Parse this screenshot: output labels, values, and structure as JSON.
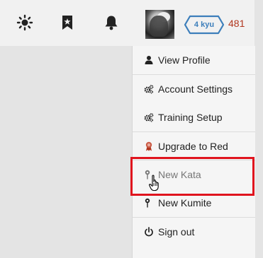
{
  "header": {
    "icons": [
      "sun-icon",
      "bookmark-star-icon",
      "bell-icon"
    ],
    "rank": "4 kyu",
    "honor": "481",
    "colors": {
      "rank": "#3c7ebb",
      "honor": "#b1361e"
    }
  },
  "menu": {
    "items": [
      {
        "label": "View Profile",
        "icon": "user-icon"
      },
      {
        "label": "Account Settings",
        "icon": "cogs-icon"
      },
      {
        "label": "Training Setup",
        "icon": "cogs-icon"
      },
      {
        "label": "Upgrade to Red",
        "icon": "ribbon-icon"
      },
      {
        "label": "New Kata",
        "icon": "map-pin-icon"
      },
      {
        "label": "New Kumite",
        "icon": "map-pin-icon"
      },
      {
        "label": "Sign out",
        "icon": "power-icon"
      }
    ],
    "hovered_item": "New Kata",
    "highlight_color": "#e0141e"
  }
}
